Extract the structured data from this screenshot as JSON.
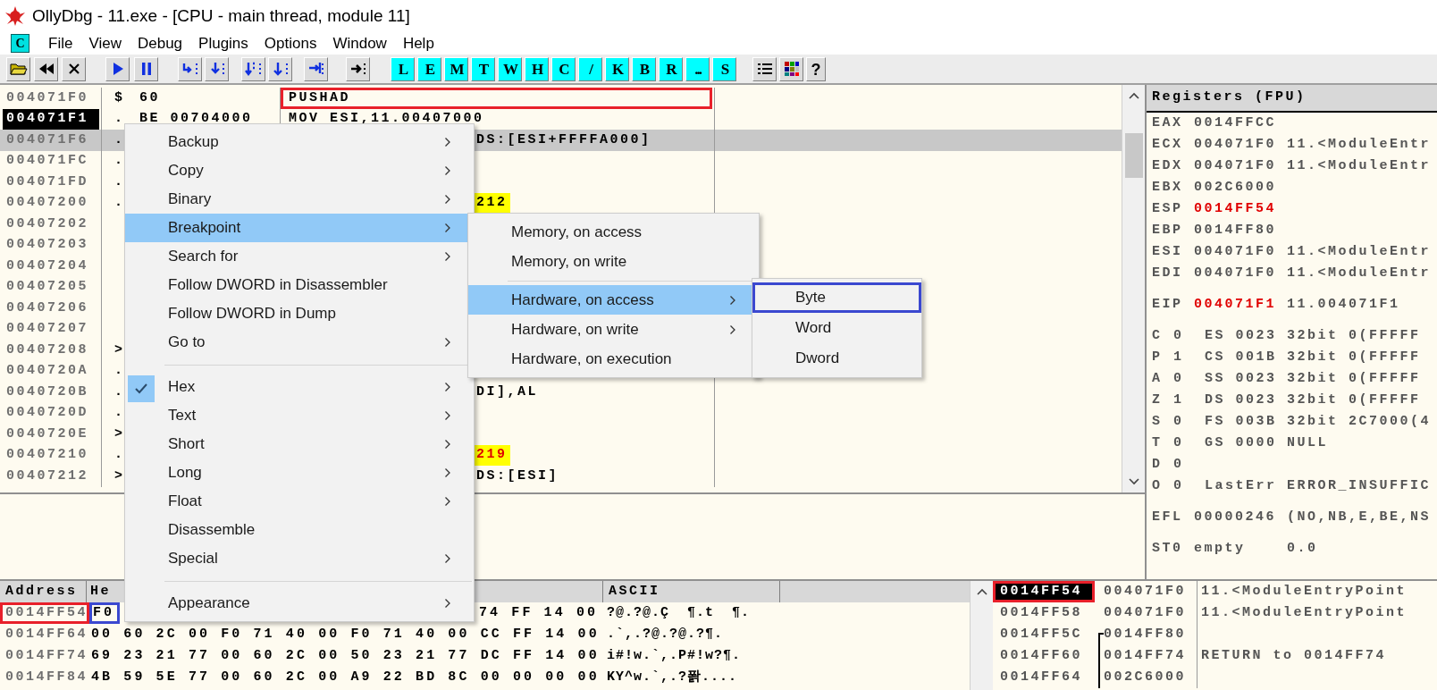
{
  "window": {
    "title": "OllyDbg - 11.exe - [CPU - main thread, module 11]"
  },
  "menu_bar": {
    "logo": "C",
    "items": [
      "File",
      "View",
      "Debug",
      "Plugins",
      "Options",
      "Window",
      "Help"
    ]
  },
  "toolbar": {
    "letter_buttons": [
      "L",
      "E",
      "M",
      "T",
      "W",
      "H",
      "C",
      "/",
      "K",
      "B",
      "R",
      "...",
      "S"
    ],
    "help_button": "?"
  },
  "disassembly": {
    "rows": [
      {
        "address": "004071F0",
        "marker": "$",
        "hex": "60",
        "command": "PUSHAD",
        "kind": "full",
        "current": false,
        "selected": false,
        "highlighted": false,
        "red_text": false,
        "color": "#e8202a"
      },
      {
        "address": "004071F1",
        "marker": ".",
        "hex": "BE 00704000",
        "command": "MOV ESI,11.00407000",
        "kind": "full",
        "current": true,
        "selected": false,
        "highlighted": false,
        "red_text": false
      },
      {
        "address": "004071F6",
        "marker": ".",
        "command": "DS:[ESI+FFFFA000]",
        "kind": "partial",
        "current": false,
        "selected": true,
        "highlighted": false,
        "red_text": false
      },
      {
        "address": "004071FC",
        "marker": ".",
        "current": false,
        "selected": false
      },
      {
        "address": "004071FD",
        "marker": ".",
        "current": false,
        "selected": false
      },
      {
        "address": "00407200",
        "marker": ".",
        "command": "212",
        "kind": "partial",
        "current": false,
        "selected": false,
        "highlighted": true,
        "red_text": false
      },
      {
        "address": "00407202",
        "current": false,
        "selected": false
      },
      {
        "address": "00407203",
        "current": false,
        "selected": false
      },
      {
        "address": "00407204",
        "current": false,
        "selected": false
      },
      {
        "address": "00407205",
        "current": false,
        "selected": false
      },
      {
        "address": "00407206",
        "current": false,
        "selected": false
      },
      {
        "address": "00407207",
        "current": false,
        "selected": false
      },
      {
        "address": "00407208",
        "marker": ">",
        "current": false,
        "selected": false
      },
      {
        "address": "0040720A",
        "marker": ".",
        "current": false,
        "selected": false
      },
      {
        "address": "0040720B",
        "marker": ".",
        "command": "DI],AL",
        "kind": "partial",
        "current": false,
        "selected": false,
        "highlighted": false,
        "red_text": false
      },
      {
        "address": "0040720D",
        "marker": ".",
        "current": false,
        "selected": false
      },
      {
        "address": "0040720E",
        "marker": ">",
        "current": false,
        "selected": false
      },
      {
        "address": "00407210",
        "marker": ".",
        "command": "219",
        "kind": "partial",
        "current": false,
        "selected": false,
        "highlighted": true,
        "red_text": true
      },
      {
        "address": "00407212",
        "marker": ">",
        "command": "DS:[ESI]",
        "kind": "partial",
        "current": false,
        "selected": false,
        "highlighted": false,
        "red_text": false
      }
    ]
  },
  "registers": {
    "title": "Registers (FPU)",
    "groups": [
      [
        {
          "kind": "register",
          "name": "EAX",
          "value": "0014FFCC",
          "changed": false
        },
        {
          "kind": "register",
          "name": "ECX",
          "value": "004071F0",
          "comment": "11.<ModuleEntr",
          "changed": false
        },
        {
          "kind": "register",
          "name": "EDX",
          "value": "004071F0",
          "comment": "11.<ModuleEntr",
          "changed": false
        },
        {
          "kind": "register",
          "name": "EBX",
          "value": "002C6000",
          "changed": false
        },
        {
          "kind": "register",
          "name": "ESP",
          "value": "0014FF54",
          "changed": true
        },
        {
          "kind": "register",
          "name": "EBP",
          "value": "0014FF80",
          "changed": false
        },
        {
          "kind": "register",
          "name": "ESI",
          "value": "004071F0",
          "comment": "11.<ModuleEntr",
          "changed": false
        },
        {
          "kind": "register",
          "name": "EDI",
          "value": "004071F0",
          "comment": "11.<ModuleEntr",
          "changed": false
        }
      ],
      [
        {
          "kind": "register",
          "name": "EIP",
          "value": "004071F1",
          "comment": "11.004071F1",
          "changed": true
        }
      ],
      [
        {
          "kind": "flag",
          "name": "C",
          "value": "0",
          "detail": "ES 0023 32bit 0(FFFFF"
        },
        {
          "kind": "flag",
          "name": "P",
          "value": "1",
          "detail": "CS 001B 32bit 0(FFFFF"
        },
        {
          "kind": "flag",
          "name": "A",
          "value": "0",
          "detail": "SS 0023 32bit 0(FFFFF"
        },
        {
          "kind": "flag",
          "name": "Z",
          "value": "1",
          "detail": "DS 0023 32bit 0(FFFFF"
        },
        {
          "kind": "flag",
          "name": "S",
          "value": "0",
          "detail": "FS 003B 32bit 2C7000(4"
        },
        {
          "kind": "flag",
          "name": "T",
          "value": "0",
          "detail": "GS 0000 NULL"
        },
        {
          "kind": "flag",
          "name": "D",
          "value": "0"
        },
        {
          "kind": "flag",
          "name": "O",
          "value": "0",
          "detail": "LastErr ERROR_INSUFFIC"
        }
      ],
      [
        {
          "kind": "register",
          "name": "EFL",
          "value": "00000246",
          "comment": "(NO,NB,E,BE,NS",
          "changed": false
        }
      ],
      [
        {
          "kind": "register",
          "name": "ST0",
          "value": "empty",
          "comment": "0.0",
          "changed": false
        }
      ]
    ]
  },
  "dump": {
    "columns": [
      "Address",
      "He",
      "ASCII"
    ],
    "rows": [
      {
        "address": "0014FF54",
        "color": "#e8202a",
        "first_byte": {
          "text": "F0",
          "color": "#3b48d0"
        },
        "hex": "74 FF 14 00",
        "kind": "partial",
        "ascii": "?@.?@.Ç  ¶.t  ¶."
      },
      {
        "address": "0014FF64",
        "hex": "00 60 2C 00 F0 71 40 00 F0 71 40 00 CC FF 14 00",
        "kind": "full",
        "ascii": ".`,.?@.?@.?¶."
      },
      {
        "address": "0014FF74",
        "hex": "69 23 21 77 00 60 2C 00 50 23 21 77 DC FF 14 00",
        "kind": "full",
        "ascii": "i#!w.`,.P#!w?¶."
      },
      {
        "address": "0014FF84",
        "hex": "4B 59 5E 77 00 60 2C 00 A9 22 BD 8C 00 00 00 00",
        "kind": "full",
        "ascii": "KY^w.`,.?퐑...."
      }
    ]
  },
  "stack": {
    "rows": [
      {
        "address": "0014FF54",
        "value": "004071F0",
        "comment": "11.<ModuleEntryPoint",
        "current": true,
        "color": "#e8202a",
        "kind": "plain"
      },
      {
        "address": "0014FF58",
        "value": "004071F0",
        "comment": "11.<ModuleEntryPoint",
        "current": false,
        "kind": "plain"
      },
      {
        "address": "0014FF5C",
        "value": "0014FF80",
        "current": false,
        "kind": "frame_start"
      },
      {
        "address": "0014FF60",
        "value": "0014FF74",
        "comment": "RETURN to 0014FF74",
        "current": false,
        "kind": "frame_line"
      },
      {
        "address": "0014FF64",
        "value": "002C6000",
        "current": false,
        "kind": "frame_line"
      }
    ]
  },
  "context_menu": {
    "items": [
      {
        "kind": "item",
        "label": "Backup",
        "submenu": true,
        "selected": false,
        "checked": false
      },
      {
        "kind": "item",
        "label": "Copy",
        "submenu": true,
        "selected": false,
        "checked": false
      },
      {
        "kind": "item",
        "label": "Binary",
        "submenu": true,
        "selected": false,
        "checked": false
      },
      {
        "kind": "item",
        "label": "Breakpoint",
        "submenu": true,
        "selected": true,
        "checked": false
      },
      {
        "kind": "item",
        "label": "Search for",
        "submenu": true,
        "selected": false,
        "checked": false
      },
      {
        "kind": "item",
        "label": "Follow DWORD in Disassembler",
        "submenu": false,
        "selected": false,
        "checked": false
      },
      {
        "kind": "item",
        "label": "Follow DWORD in Dump",
        "submenu": false,
        "selected": false,
        "checked": false
      },
      {
        "kind": "item",
        "label": "Go to",
        "submenu": true,
        "selected": false,
        "checked": false
      },
      {
        "kind": "separator"
      },
      {
        "kind": "item",
        "label": "Hex",
        "submenu": true,
        "selected": false,
        "checked": true
      },
      {
        "kind": "item",
        "label": "Text",
        "submenu": true,
        "selected": false,
        "checked": false
      },
      {
        "kind": "item",
        "label": "Short",
        "submenu": true,
        "selected": false,
        "checked": false
      },
      {
        "kind": "item",
        "label": "Long",
        "submenu": true,
        "selected": false,
        "checked": false
      },
      {
        "kind": "item",
        "label": "Float",
        "submenu": true,
        "selected": false,
        "checked": false
      },
      {
        "kind": "item",
        "label": "Disassemble",
        "submenu": false,
        "selected": false,
        "checked": false
      },
      {
        "kind": "item",
        "label": "Special",
        "submenu": true,
        "selected": false,
        "checked": false
      },
      {
        "kind": "separator"
      },
      {
        "kind": "item",
        "label": "Appearance",
        "submenu": true,
        "selected": false,
        "checked": false
      }
    ]
  },
  "breakpoint_submenu": {
    "items": [
      {
        "kind": "item",
        "label": "Memory, on access",
        "submenu": false,
        "selected": false
      },
      {
        "kind": "item",
        "label": "Memory, on write",
        "submenu": false,
        "selected": false
      },
      {
        "kind": "separator"
      },
      {
        "kind": "item",
        "label": "Hardware, on access",
        "submenu": true,
        "selected": true
      },
      {
        "kind": "item",
        "label": "Hardware, on write",
        "submenu": true,
        "selected": false
      },
      {
        "kind": "item",
        "label": "Hardware, on execution",
        "submenu": false,
        "selected": false
      }
    ]
  },
  "size_submenu": {
    "items": [
      {
        "kind": "item",
        "label": "Byte",
        "submenu": false,
        "selected": false,
        "color": "#3b48d0"
      },
      {
        "kind": "item",
        "label": "Word",
        "submenu": false,
        "selected": false
      },
      {
        "kind": "item",
        "label": "Dword",
        "submenu": false,
        "selected": false
      }
    ]
  }
}
